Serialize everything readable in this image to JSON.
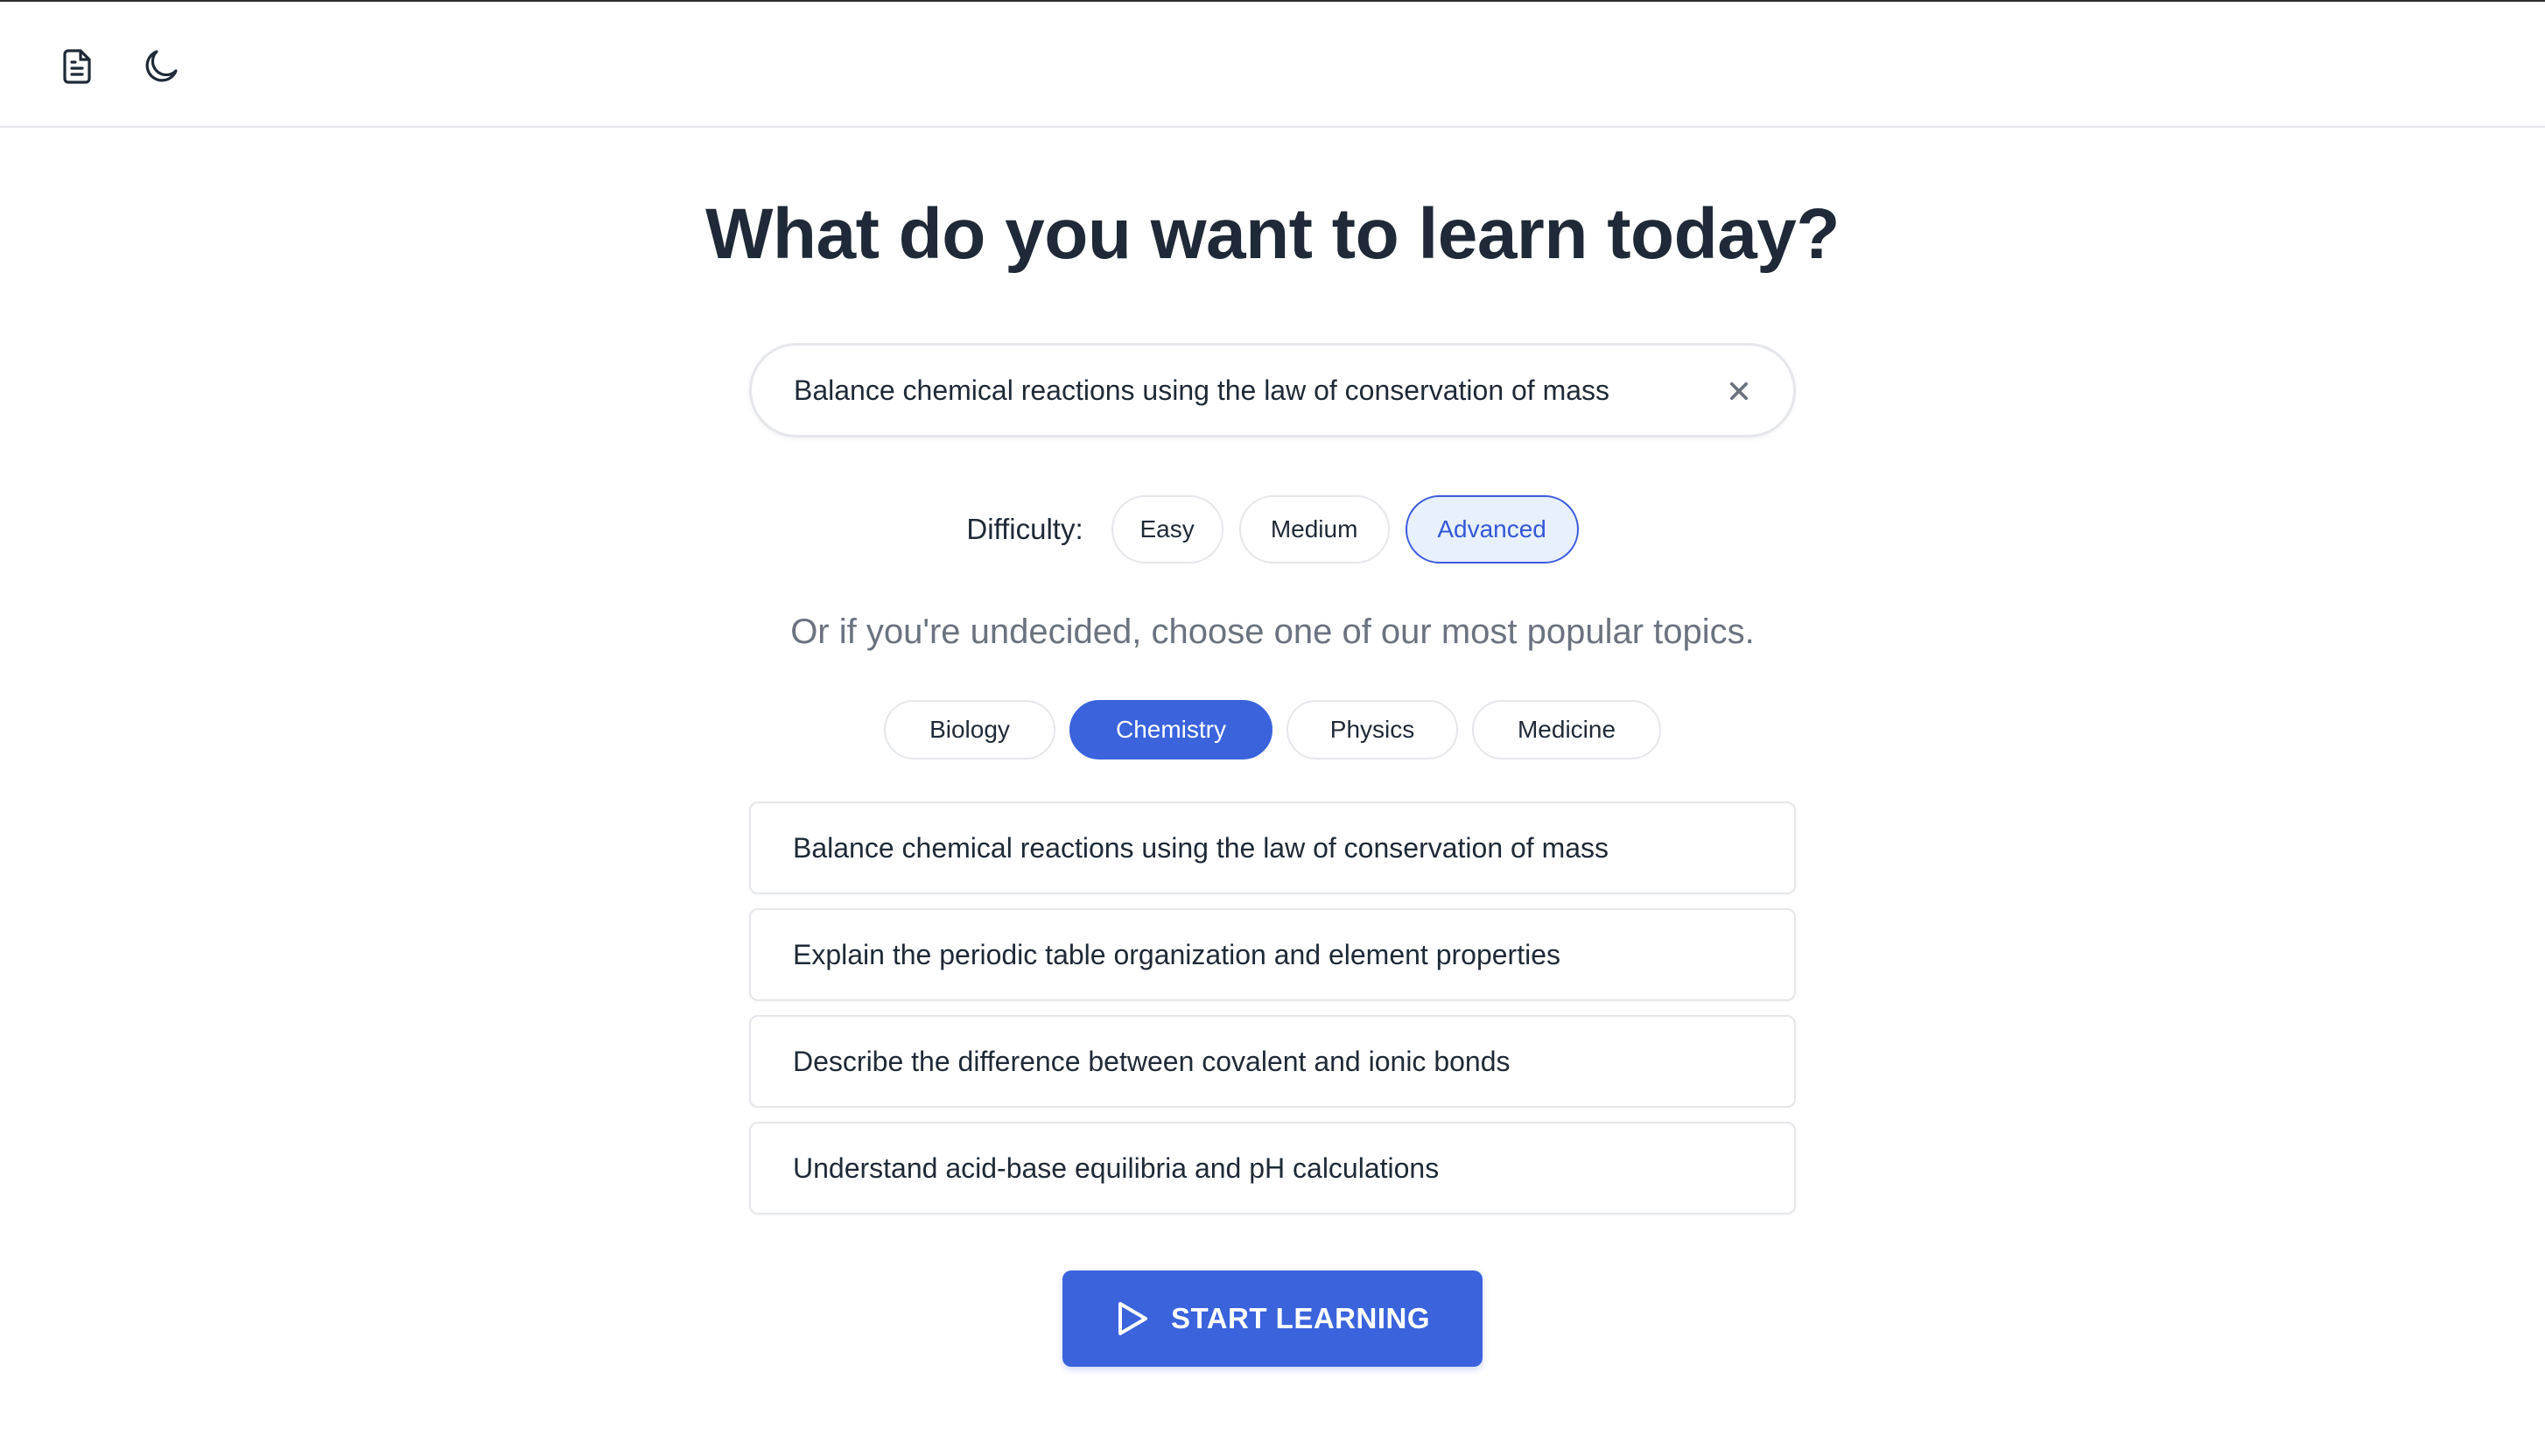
{
  "header": {
    "icons": [
      "document-icon",
      "moon-icon"
    ]
  },
  "main": {
    "title": "What do you want to learn today?",
    "search": {
      "value": "Balance chemical reactions using the law of conservation of mass"
    },
    "difficulty": {
      "label": "Difficulty:",
      "options": [
        "Easy",
        "Medium",
        "Advanced"
      ],
      "selected": "Advanced"
    },
    "subtitle": "Or if you're undecided, choose one of our most popular topics.",
    "topics": {
      "items": [
        "Biology",
        "Chemistry",
        "Physics",
        "Medicine"
      ],
      "selected": "Chemistry"
    },
    "suggestions": [
      "Balance chemical reactions using the law of conservation of mass",
      "Explain the periodic table organization and element properties",
      "Describe the difference between covalent and ionic bonds",
      "Understand acid-base equilibria and pH calculations"
    ],
    "start_button": "START LEARNING"
  },
  "colors": {
    "accent": "#3a63dc",
    "selected_light_bg": "#e8f0fe",
    "text": "#1f2937",
    "muted_text": "#6b7280",
    "border": "#e5e7eb"
  }
}
